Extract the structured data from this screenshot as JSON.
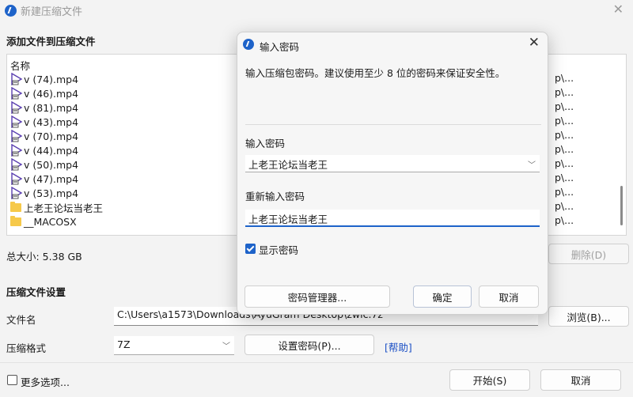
{
  "window": {
    "title": "新建压缩文件"
  },
  "add_section": {
    "title": "添加文件到压缩文件",
    "column_name": "名称"
  },
  "files": [
    {
      "name": "v (74).mp4",
      "type": "video"
    },
    {
      "name": "v (46).mp4",
      "type": "video"
    },
    {
      "name": "v (81).mp4",
      "type": "video"
    },
    {
      "name": "v (43).mp4",
      "type": "video"
    },
    {
      "name": "v (70).mp4",
      "type": "video"
    },
    {
      "name": "v (44).mp4",
      "type": "video"
    },
    {
      "name": "v (50).mp4",
      "type": "video"
    },
    {
      "name": "v (47).mp4",
      "type": "video"
    },
    {
      "name": "v (53).mp4",
      "type": "video"
    },
    {
      "name": "上老王论坛当老王",
      "type": "folder"
    },
    {
      "name": "__MACOSX",
      "type": "folder"
    }
  ],
  "path_column_fragment": "p\\...",
  "total_size": "总大小: 5.38 GB",
  "delete_button": "删除(D)",
  "settings": {
    "title": "压缩文件设置",
    "filename_label": "文件名",
    "filename_value": "C:\\Users\\a1573\\Downloads\\AyuGram Desktop\\zwic.7z",
    "browse_button": "浏览(B)...",
    "format_label": "压缩格式",
    "format_value": "7Z",
    "set_password_button": "设置密码(P)...",
    "help_link": "[帮助]"
  },
  "more_options": "更多选项...",
  "start_button": "开始(S)",
  "cancel_button": "取消",
  "dialog": {
    "title": "输入密码",
    "description": "输入压缩包密码。建议使用至少 8 位的密码来保证安全性。",
    "password_label": "输入密码",
    "password_value": "上老王论坛当老王",
    "confirm_label": "重新输入密码",
    "confirm_value": "上老王论坛当老王",
    "show_password": "显示密码",
    "password_manager_button": "密码管理器...",
    "ok_button": "确定",
    "cancel_button": "取消"
  },
  "colors": {
    "accent": "#1e63c9",
    "folder": "#f6c94a",
    "link": "#1a4fc5"
  }
}
